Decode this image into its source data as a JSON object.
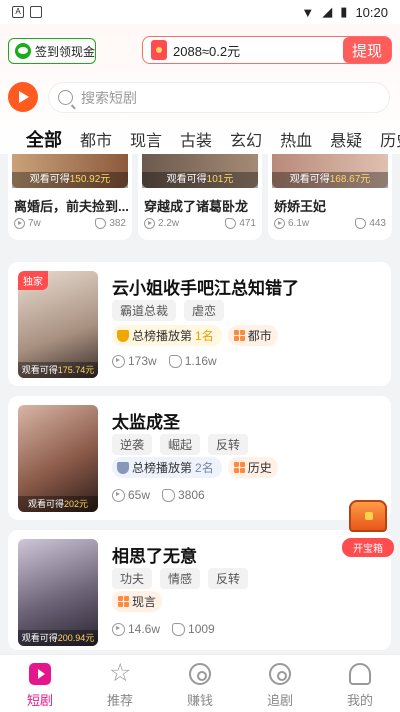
{
  "status_bar": {
    "time": "10:20"
  },
  "header": {
    "checkin_label": "签到领现金",
    "coins_text": "2088≈0.2元",
    "withdraw_label": "提现",
    "search_placeholder": "搜索短剧"
  },
  "tabs": [
    "全部",
    "都市",
    "现言",
    "古装",
    "玄幻",
    "热血",
    "悬疑",
    "历史"
  ],
  "grid": [
    {
      "earn_prefix": "观看可得",
      "earn_value": "150.92元",
      "title": "离婚后，前夫捡到...",
      "views": "7w",
      "shares": "382"
    },
    {
      "earn_prefix": "观看可得",
      "earn_value": "101元",
      "title": "穿越成了诸葛卧龙",
      "views": "2.2w",
      "shares": "471"
    },
    {
      "earn_prefix": "观看可得",
      "earn_value": "168.67元",
      "title": "娇娇王妃",
      "views": "6.1w",
      "shares": "443"
    }
  ],
  "list": [
    {
      "exclusive": "独家",
      "title": "云小姐收手吧江总知错了",
      "tags": [
        "霸道总裁",
        "虐恋"
      ],
      "rank_prefix": "总榜播放第",
      "rank_num": "1名",
      "genre": "都市",
      "earn_prefix": "观看可得",
      "earn_value": "175.74元",
      "views": "173w",
      "shares": "1.16w"
    },
    {
      "title": "太监成圣",
      "tags": [
        "逆袭",
        "崛起",
        "反转"
      ],
      "rank_prefix": "总榜播放第",
      "rank_num": "2名",
      "genre": "历史",
      "earn_prefix": "观看可得",
      "earn_value": "202元",
      "views": "65w",
      "shares": "3806"
    },
    {
      "title": "相思了无意",
      "tags": [
        "功夫",
        "情感",
        "反转"
      ],
      "genre": "现言",
      "earn_prefix": "观看可得",
      "earn_value": "200.94元",
      "views": "14.6w",
      "shares": "1009"
    }
  ],
  "float": {
    "treasure_label": "开宝箱"
  },
  "bottom_nav": [
    "短剧",
    "推荐",
    "赚钱",
    "追剧",
    "我的"
  ],
  "colors": {
    "accent": "#e5168c",
    "withdraw": "#ff5c5c",
    "wechat": "#1aad19"
  }
}
